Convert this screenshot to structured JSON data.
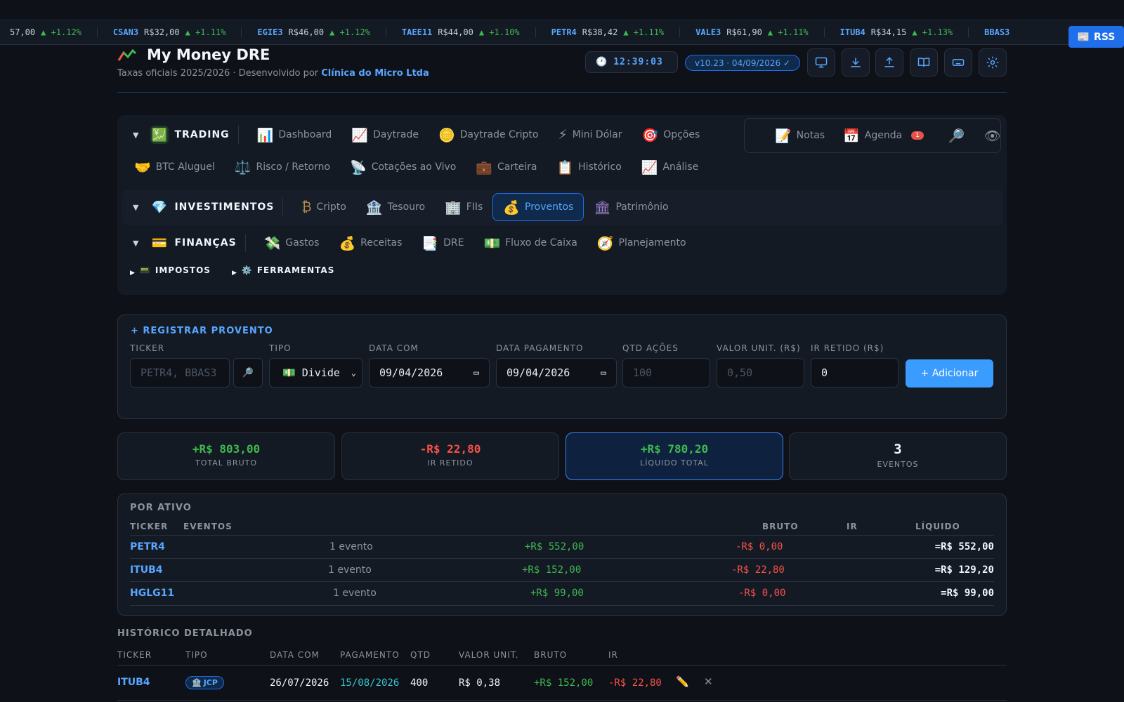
{
  "ticker": [
    {
      "sym": "",
      "price": "57,00",
      "chg": "▲ +1.12%"
    },
    {
      "sym": "CSAN3",
      "price": "R$32,00",
      "chg": "▲ +1.11%"
    },
    {
      "sym": "EGIE3",
      "price": "R$46,00",
      "chg": "▲ +1.12%"
    },
    {
      "sym": "TAEE11",
      "price": "R$44,00",
      "chg": "▲ +1.10%"
    },
    {
      "sym": "PETR4",
      "price": "R$38,42",
      "chg": "▲ +1.11%"
    },
    {
      "sym": "VALE3",
      "price": "R$61,90",
      "chg": "▲ +1.11%"
    },
    {
      "sym": "ITUB4",
      "price": "R$34,15",
      "chg": "▲ +1.13%"
    },
    {
      "sym": "BBAS3",
      "price": "",
      "chg": ""
    }
  ],
  "rss_label": "RSS",
  "header": {
    "title": "My Money DRE",
    "subtitle_prefix": "Taxas oficiais 2025/2026 · Desenvolvido por ",
    "subtitle_company": "Clínica do Micro Ltda",
    "clock": "12:39:03",
    "version": "v10.23 · 04/09/2026 ✓"
  },
  "nav": {
    "trading": {
      "label": "TRADING",
      "items": [
        {
          "label": "Dashboard",
          "icon": "📊"
        },
        {
          "label": "Daytrade",
          "icon": "📈"
        },
        {
          "label": "Daytrade Cripto",
          "icon": "🪙"
        },
        {
          "label": "Mini Dólar",
          "icon": "⚡"
        },
        {
          "label": "Opções",
          "icon": "🎯"
        },
        {
          "label": "BTC Aluguel",
          "icon": "🤝"
        },
        {
          "label": "Risco / Retorno",
          "icon": "⚖️"
        },
        {
          "label": "Cotações ao Vivo",
          "icon": "📡"
        },
        {
          "label": "Carteira",
          "icon": "💼"
        },
        {
          "label": "Histórico",
          "icon": "📋"
        },
        {
          "label": "Análise",
          "icon": "📈"
        }
      ]
    },
    "quick": {
      "notas": "Notas",
      "agenda": "Agenda",
      "agenda_badge": "1"
    },
    "investimentos": {
      "label": "INVESTIMENTOS",
      "items": [
        {
          "label": "Cripto",
          "icon": "₿"
        },
        {
          "label": "Tesouro",
          "icon": "🏦"
        },
        {
          "label": "FIIs",
          "icon": "🏢"
        },
        {
          "label": "Proventos",
          "icon": "💰"
        },
        {
          "label": "Patrimônio",
          "icon": "🏛"
        }
      ]
    },
    "financas": {
      "label": "FINANÇAS",
      "items": [
        {
          "label": "Gastos",
          "icon": "💸"
        },
        {
          "label": "Receitas",
          "icon": "💰"
        },
        {
          "label": "DRE",
          "icon": "📑"
        },
        {
          "label": "Fluxo de Caixa",
          "icon": "💵"
        },
        {
          "label": "Planejamento",
          "icon": "🧭"
        }
      ]
    },
    "impostos": "IMPOSTOS",
    "ferramentas": "FERRAMENTAS"
  },
  "form": {
    "title": "+ REGISTRAR PROVENTO",
    "labels": {
      "ticker": "TICKER",
      "tipo": "TIPO",
      "data_com": "DATA COM",
      "data_pag": "DATA PAGAMENTO",
      "qtd": "QTD AÇÕES",
      "valor": "VALOR UNIT. (R$)",
      "ir": "IR RETIDO (R$)"
    },
    "ticker_placeholder": "PETR4, BBAS3...",
    "tipo_value": "💵 Divide",
    "data_com_value": "09/04/2026",
    "data_pag_value": "09/04/2026",
    "qtd_placeholder": "100",
    "valor_placeholder": "0,50",
    "ir_value": "0",
    "add_label": "+ Adicionar"
  },
  "stats": [
    {
      "value": "+R$ 803,00",
      "label": "TOTAL BRUTO"
    },
    {
      "value": "-R$ 22,80",
      "label": "IR RETIDO"
    },
    {
      "value": "+R$ 780,20",
      "label": "LÍQUIDO TOTAL"
    },
    {
      "value": "3",
      "label": "EVENTOS"
    }
  ],
  "por_ativo": {
    "title": "POR ATIVO",
    "headers": {
      "ticker": "TICKER",
      "eventos": "EVENTOS",
      "bruto": "BRUTO",
      "ir": "IR",
      "liquido": "LÍQUIDO"
    },
    "rows": [
      {
        "ticker": "PETR4",
        "eventos": "1 evento",
        "bruto": "+R$ 552,00",
        "ir": "-R$ 0,00",
        "liquido": "=R$ 552,00"
      },
      {
        "ticker": "ITUB4",
        "eventos": "1 evento",
        "bruto": "+R$ 152,00",
        "ir": "-R$ 22,80",
        "liquido": "=R$ 129,20"
      },
      {
        "ticker": "HGLG11",
        "eventos": "1 evento",
        "bruto": "+R$ 99,00",
        "ir": "-R$ 0,00",
        "liquido": "=R$ 99,00"
      }
    ]
  },
  "historico": {
    "title": "HISTÓRICO DETALHADO",
    "headers": {
      "ticker": "TICKER",
      "tipo": "TIPO",
      "data_com": "DATA COM",
      "pagamento": "PAGAMENTO",
      "qtd": "QTD",
      "valor": "VALOR UNIT.",
      "bruto": "BRUTO",
      "ir": "IR"
    },
    "rows": [
      {
        "ticker": "ITUB4",
        "tipo": "JCP",
        "data_com": "26/07/2026",
        "pagamento": "15/08/2026",
        "qtd": "400",
        "valor": "R$ 0,38",
        "bruto": "+R$ 152,00",
        "ir": "-R$ 22,80"
      }
    ]
  },
  "colors": {
    "accent": "#58a6ff",
    "positive": "#3fb950",
    "negative": "#f85149",
    "background": "#0e1117"
  }
}
